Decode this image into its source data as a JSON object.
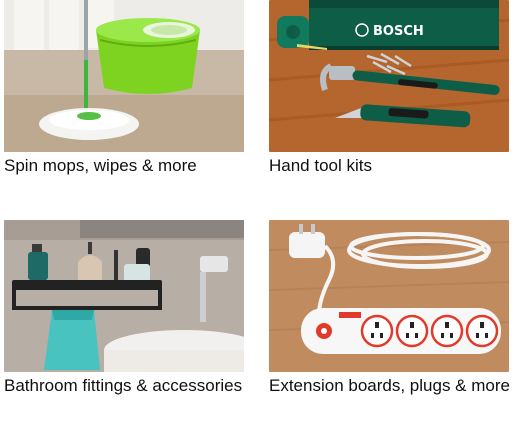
{
  "tiles": [
    {
      "label": "Spin mops, wipes & more",
      "image": "spin-mop-bucket"
    },
    {
      "label": "Hand tool kits",
      "image": "hand-tool-kit",
      "brand_text": "BOSCH"
    },
    {
      "label": "Bathroom fittings & accessories",
      "image": "bathroom-shelf"
    },
    {
      "label": "Extension boards, plugs & more",
      "image": "extension-board"
    }
  ],
  "colors": {
    "text": "#0f1111",
    "mop_green": "#7ed321",
    "bosch_green": "#0e5d46",
    "wood": "#b5652e"
  }
}
